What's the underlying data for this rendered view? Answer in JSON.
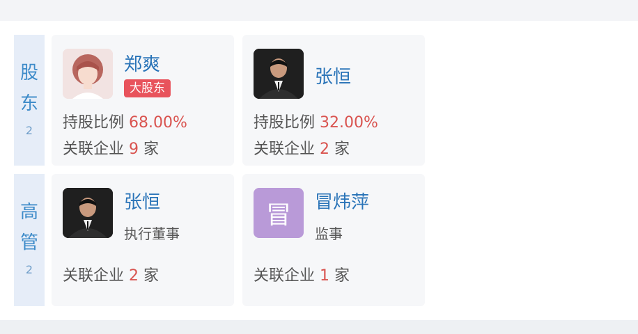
{
  "shareholders": {
    "label_chars": [
      "股",
      "东"
    ],
    "count": "2",
    "items": [
      {
        "name": "郑爽",
        "badge": "大股东",
        "ratio_label": "持股比例",
        "ratio_value": "68.00%",
        "related_label": "关联企业",
        "related_count": "9",
        "related_unit": "家"
      },
      {
        "name": "张恒",
        "ratio_label": "持股比例",
        "ratio_value": "32.00%",
        "related_label": "关联企业",
        "related_count": "2",
        "related_unit": "家"
      }
    ]
  },
  "executives": {
    "label_chars": [
      "高",
      "管"
    ],
    "count": "2",
    "items": [
      {
        "name": "张恒",
        "role": "执行董事",
        "related_label": "关联企业",
        "related_count": "2",
        "related_unit": "家"
      },
      {
        "name": "冒炜萍",
        "avatar_text": "冒",
        "role": "监事",
        "related_label": "关联企业",
        "related_count": "1",
        "related_unit": "家"
      }
    ]
  },
  "colors": {
    "accent_blue": "#2a74b8",
    "number_red": "#d9534f",
    "badge_red": "#e8535c",
    "avatar_purple": "#b99ad8"
  }
}
